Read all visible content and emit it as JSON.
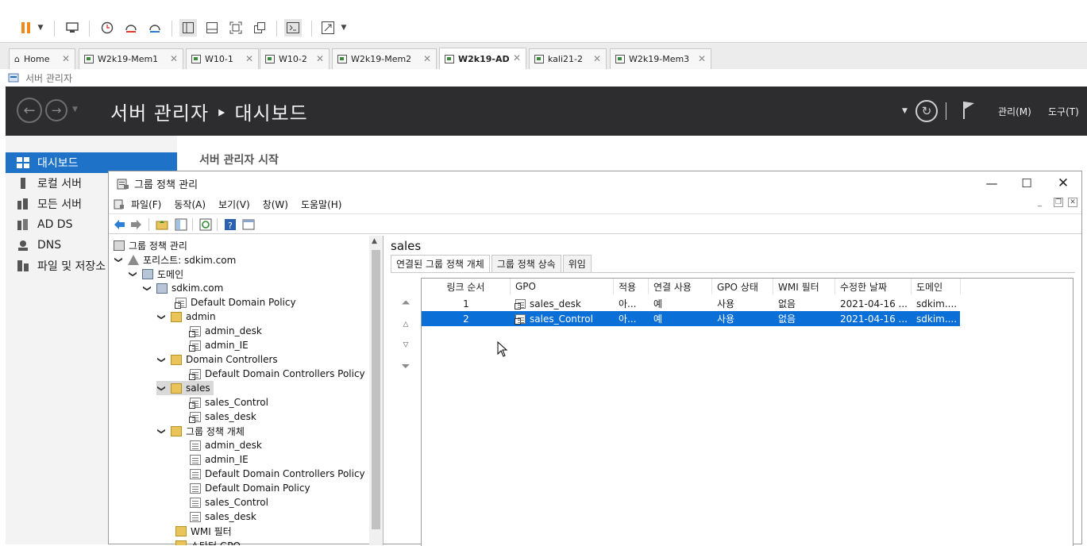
{
  "vm_tabs": [
    {
      "label": "Home"
    },
    {
      "label": "W2k19-Mem1"
    },
    {
      "label": "W10-1"
    },
    {
      "label": "W10-2"
    },
    {
      "label": "W2k19-Mem2"
    },
    {
      "label": "W2k19-AD"
    },
    {
      "label": "kali21-2"
    },
    {
      "label": "W2k19-Mem3"
    }
  ],
  "guest_bar": {
    "title": "서버 관리자"
  },
  "server_manager": {
    "header_title": "서버 관리자 ‣ 대시보드",
    "manage_label": "관리(M)",
    "tools_label": "도구(T)",
    "sidebar": [
      "대시보드",
      "로컬 서버",
      "모든 서버",
      "AD DS",
      "DNS",
      "파일 및 저장소"
    ],
    "welcome": "서버 관리자 시작"
  },
  "gpmc": {
    "title": "그룹 정책 관리",
    "menu": [
      "파일(F)",
      "동작(A)",
      "보기(V)",
      "창(W)",
      "도움말(H)"
    ],
    "tree": [
      {
        "label": "그룹 정책 관리"
      },
      {
        "label": "포리스트: sdkim.com"
      },
      {
        "label": "도메인"
      },
      {
        "label": "sdkim.com"
      },
      {
        "label": "Default Domain Policy"
      },
      {
        "label": "admin"
      },
      {
        "label": "admin_desk"
      },
      {
        "label": "admin_IE"
      },
      {
        "label": "Domain Controllers"
      },
      {
        "label": "Default Domain Controllers Policy"
      },
      {
        "label": "sales"
      },
      {
        "label": "sales_Control"
      },
      {
        "label": "sales_desk"
      },
      {
        "label": "그룹 정책 개체"
      },
      {
        "label": "admin_desk"
      },
      {
        "label": "admin_IE"
      },
      {
        "label": "Default Domain Controllers Policy"
      },
      {
        "label": "Default Domain Policy"
      },
      {
        "label": "sales_Control"
      },
      {
        "label": "sales_desk"
      },
      {
        "label": "WMI 필터"
      },
      {
        "label": "스타터 GPO"
      }
    ],
    "right": {
      "title": "sales",
      "tabs": [
        "연결된 그룹 정책 개체",
        "그룹 정책 상속",
        "위임"
      ],
      "columns": [
        "링크 순서",
        "GPO",
        "적용",
        "연결 사용",
        "GPO 상태",
        "WMI 필터",
        "수정한 날짜",
        "도메인"
      ],
      "rows": [
        {
          "order": "1",
          "gpo": "sales_desk",
          "enforced": "아...",
          "link_enabled": "예",
          "status": "사용",
          "wmi": "없음",
          "modified": "2021-04-16 ...",
          "domain": "sdkim...."
        },
        {
          "order": "2",
          "gpo": "sales_Control",
          "enforced": "아...",
          "link_enabled": "예",
          "status": "사용",
          "wmi": "없음",
          "modified": "2021-04-16 ...",
          "domain": "sdkim...."
        }
      ]
    }
  }
}
